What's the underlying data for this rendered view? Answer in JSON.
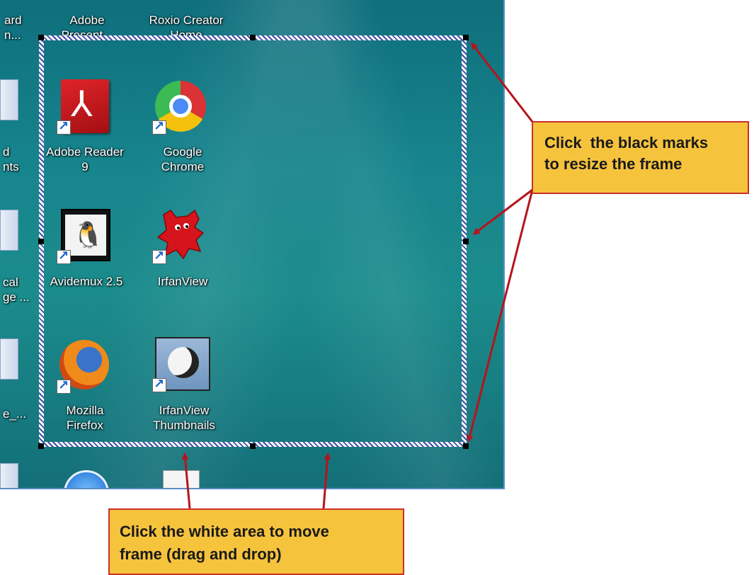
{
  "desktop": {
    "top_labels": [
      {
        "id": "clip-ard",
        "text": "ard\nn..."
      },
      {
        "id": "adobe-present",
        "text": "Adobe\nPresent..."
      },
      {
        "id": "roxio",
        "text": "Roxio Creator\nHome"
      }
    ],
    "icons": [
      {
        "label": "Adobe Reader\n9",
        "icon": "adobe-reader-icon"
      },
      {
        "label": "Google\nChrome",
        "icon": "chrome-icon"
      },
      {
        "label": "Avidemux 2.5",
        "icon": "avidemux-icon"
      },
      {
        "label": "IrfanView",
        "icon": "irfanview-icon"
      },
      {
        "label": "Mozilla\nFirefox",
        "icon": "firefox-icon"
      },
      {
        "label": "IrfanView\nThumbnails",
        "icon": "irfanview-thumbnails-icon"
      }
    ],
    "left_clipped_labels": [
      "d\nnts",
      "cal\nge ...",
      "e_..."
    ]
  },
  "callouts": {
    "resize": "Click  the black marks\nto resize the frame",
    "move": "Click the white area to move\nframe (drag and drop)"
  },
  "colors": {
    "callout_fill": "#f6c33c",
    "callout_border": "#c9302c",
    "arrow": "#b5141c",
    "desktop": "#17858d"
  }
}
